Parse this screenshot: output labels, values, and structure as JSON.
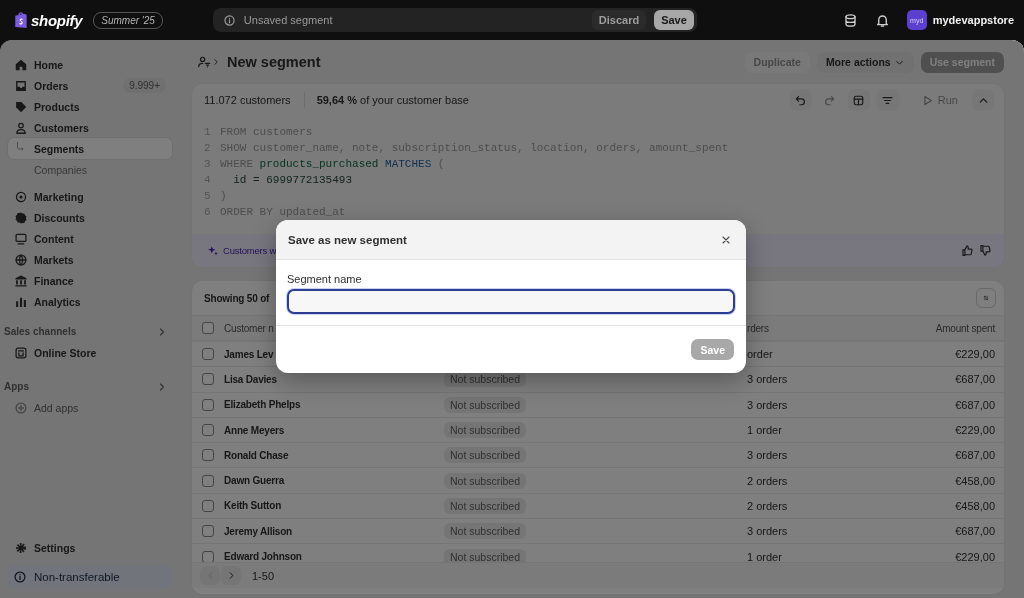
{
  "topbar": {
    "logo": "shopify",
    "edition": "Summer '25",
    "status": "Unsaved segment",
    "actions": [
      {
        "label": "Discard",
        "kind": "discard"
      },
      {
        "label": "Save",
        "kind": "save"
      }
    ],
    "avatar": "myd",
    "store": "mydevappstore"
  },
  "sidebar": {
    "groups": [
      [
        {
          "label": "Home",
          "selected": false
        },
        {
          "label": "Orders",
          "badge": "9.999+",
          "selected": false
        },
        {
          "label": "Products",
          "selected": false
        },
        {
          "label": "Customers",
          "selected": false,
          "children": [
            {
              "label": "Segments",
              "selected": true
            },
            {
              "label": "Companies",
              "selected": false
            }
          ]
        }
      ],
      [
        {
          "label": "Marketing",
          "selected": false
        },
        {
          "label": "Discounts",
          "selected": false
        },
        {
          "label": "Content",
          "selected": false
        },
        {
          "label": "Markets",
          "selected": false
        },
        {
          "label": "Finance",
          "selected": false
        },
        {
          "label": "Analytics",
          "selected": false
        }
      ]
    ],
    "sections": [
      {
        "title": "Sales channels",
        "items": [
          {
            "label": "Online Store",
            "kind": "link",
            "selected": false
          }
        ]
      },
      {
        "title": "Apps",
        "items": [
          {
            "label": "Add apps",
            "kind": "action"
          }
        ]
      }
    ],
    "settings": "Settings",
    "notice": "Non-transferable"
  },
  "page": {
    "title": "New segment",
    "actions": [
      {
        "label": "Duplicate",
        "kind": "secondary",
        "disabled": true
      },
      {
        "label": "More actions",
        "kind": "menu",
        "disabled": false
      },
      {
        "label": "Use segment",
        "kind": "primary",
        "disabled": true
      }
    ]
  },
  "editor": {
    "count": "11.072 customers",
    "share": "**59,64 %** of your customer base",
    "tools": [
      {
        "kind": "undo",
        "disabled": false
      },
      {
        "kind": "redo",
        "disabled": true
      },
      {
        "kind": "layout",
        "disabled": false
      },
      {
        "kind": "filter",
        "disabled": false
      },
      {
        "kind": "run",
        "label": "Run",
        "disabled": true
      },
      {
        "kind": "collapse",
        "disabled": false
      }
    ],
    "lines": [
      {
        "number": "1",
        "tokens": [
          {
            "text": "FROM customers",
            "kind": "plain"
          }
        ]
      },
      {
        "number": "2",
        "tokens": [
          {
            "text": "SHOW customer_name, note, subscription_status, location, orders, amount_spent",
            "kind": "plain"
          }
        ]
      },
      {
        "number": "3",
        "tokens": [
          {
            "text": "WHERE ",
            "kind": "plain"
          },
          {
            "text": "products_purchased",
            "kind": "field"
          },
          {
            "text": " MATCHES",
            "kind": "keyword"
          },
          {
            "text": " (",
            "kind": "plain"
          }
        ]
      },
      {
        "number": "4",
        "tokens": [
          {
            "text": "  id = 6999772135493",
            "kind": "value"
          }
        ]
      },
      {
        "number": "5",
        "tokens": [
          {
            "text": ")",
            "kind": "plain"
          }
        ]
      },
      {
        "number": "6",
        "tokens": [
          {
            "text": "ORDER BY updated_at",
            "kind": "plain"
          }
        ]
      }
    ],
    "suggestion": "Customers w"
  },
  "table": {
    "summary": "Showing 50 of",
    "select_all": false,
    "columns": {
      "customer": "Customer n",
      "orders": "rders",
      "amount": "Amount spent"
    },
    "rows": [
      {
        "name": "James Lev",
        "orders": "order",
        "amount": "€229,00",
        "checked": false
      },
      {
        "name": "Lisa Davies",
        "subscription": "Not subscribed",
        "orders": "3 orders",
        "amount": "€687,00",
        "checked": false
      },
      {
        "name": "Elizabeth Phelps",
        "subscription": "Not subscribed",
        "orders": "3 orders",
        "amount": "€687,00",
        "checked": false
      },
      {
        "name": "Anne Meyers",
        "subscription": "Not subscribed",
        "orders": "1 order",
        "amount": "€229,00",
        "checked": false
      },
      {
        "name": "Ronald Chase",
        "subscription": "Not subscribed",
        "orders": "3 orders",
        "amount": "€687,00",
        "checked": false
      },
      {
        "name": "Dawn Guerra",
        "subscription": "Not subscribed",
        "orders": "2 orders",
        "amount": "€458,00",
        "checked": false
      },
      {
        "name": "Keith Sutton",
        "subscription": "Not subscribed",
        "orders": "2 orders",
        "amount": "€458,00",
        "checked": false
      },
      {
        "name": "Jeremy Allison",
        "subscription": "Not subscribed",
        "orders": "3 orders",
        "amount": "€687,00",
        "checked": false
      },
      {
        "name": "Edward Johnson",
        "subscription": "Not subscribed",
        "orders": "1 order",
        "amount": "€229,00",
        "checked": false
      }
    ],
    "pagination": {
      "range": "1-50",
      "prev_disabled": true
    }
  },
  "dialog": {
    "title": "Save as new segment",
    "field_label": "Segment name",
    "focused": true,
    "save": {
      "label": "Save",
      "disabled": true
    }
  }
}
